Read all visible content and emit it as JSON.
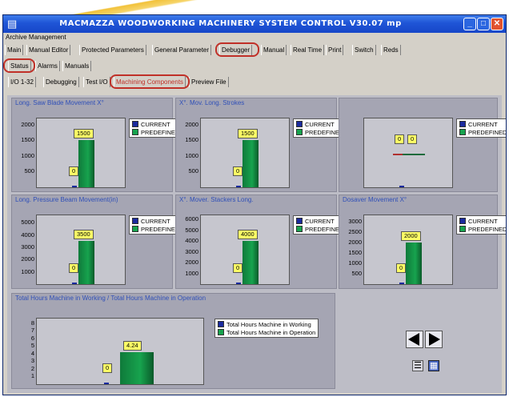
{
  "window": {
    "title": "MACMAZZA WOODWORKING MACHINERY SYSTEM CONTROL V30.07 mp",
    "menu": "Archive Management"
  },
  "tabs_main": [
    "Main",
    "Manual Editor",
    "Protected Parameters",
    "General Parameter",
    "Debugger",
    "Manual",
    "Real Time",
    "Print",
    "Switch",
    "Reds"
  ],
  "tabs_second": [
    "Status",
    "Alarms",
    "Manuals"
  ],
  "tabs_third": [
    "I/O 1-32",
    "Debugging",
    "Test I/O",
    "Machining Components",
    "Preview File"
  ],
  "highlighted": [
    "Debugger",
    "Status",
    "Machining Components"
  ],
  "legend": {
    "current": "CURRENT",
    "predefined": "PREDEFINED"
  },
  "colors": {
    "current": "#1a2a9e",
    "predefined": "#17a34e",
    "value_label": "#ffff66",
    "title_bar": "#1f55d6"
  },
  "panels": [
    {
      "title": "Long. Saw Blade Movement X°",
      "ticks": [
        "2000",
        "1500",
        "1000",
        "500"
      ],
      "ymax": 2200,
      "current": 0,
      "predefined": 1500,
      "current_label": "0",
      "predefined_label": "1500"
    },
    {
      "title": "X°. Mov. Long. Strokes",
      "ticks": [
        "2000",
        "1500",
        "1000",
        "500"
      ],
      "ymax": 2200,
      "current": 0,
      "predefined": 1500,
      "current_label": "0",
      "predefined_label": "1500"
    },
    {
      "title": "",
      "ticks": [],
      "ymax": 2200,
      "current": 0,
      "predefined": 0,
      "current_label": "0",
      "predefined_label": "0"
    },
    {
      "title": "Long. Pressure Beam Movement(in)",
      "ticks": [
        "5000",
        "4000",
        "3000",
        "2000",
        "1000"
      ],
      "ymax": 5600,
      "current": 0,
      "predefined": 3500,
      "current_label": "0",
      "predefined_label": "3500"
    },
    {
      "title": "X°. Mover. Stackers Long.",
      "ticks": [
        "6000",
        "5000",
        "4000",
        "3000",
        "2000",
        "1000"
      ],
      "ymax": 6400,
      "current": 0,
      "predefined": 4000,
      "current_label": "0",
      "predefined_label": "4000"
    },
    {
      "title": "Dosaver Movement X°",
      "ticks": [
        "3000",
        "2500",
        "2000",
        "1500",
        "1000",
        "500"
      ],
      "ymax": 3300,
      "current": 0,
      "predefined": 2000,
      "current_label": "0",
      "predefined_label": "2000"
    }
  ],
  "hours_panel": {
    "title": "Total Hours Machine in Working / Total Hours Machine in Operation",
    "ticks": [
      "8",
      "7",
      "6",
      "5",
      "4",
      "3",
      "2",
      "1"
    ],
    "ymax": 8.6,
    "working": 0,
    "operation": 4.24,
    "working_label": "0",
    "operation_label": "4.24",
    "legend_working": "Total Hours Machine in Working",
    "legend_operation": "Total Hours Machine in Operation"
  },
  "nav": {
    "prev_icon": "arrow-left-icon",
    "next_icon": "arrow-right-icon",
    "tools": [
      "list-icon",
      "save-icon"
    ]
  }
}
